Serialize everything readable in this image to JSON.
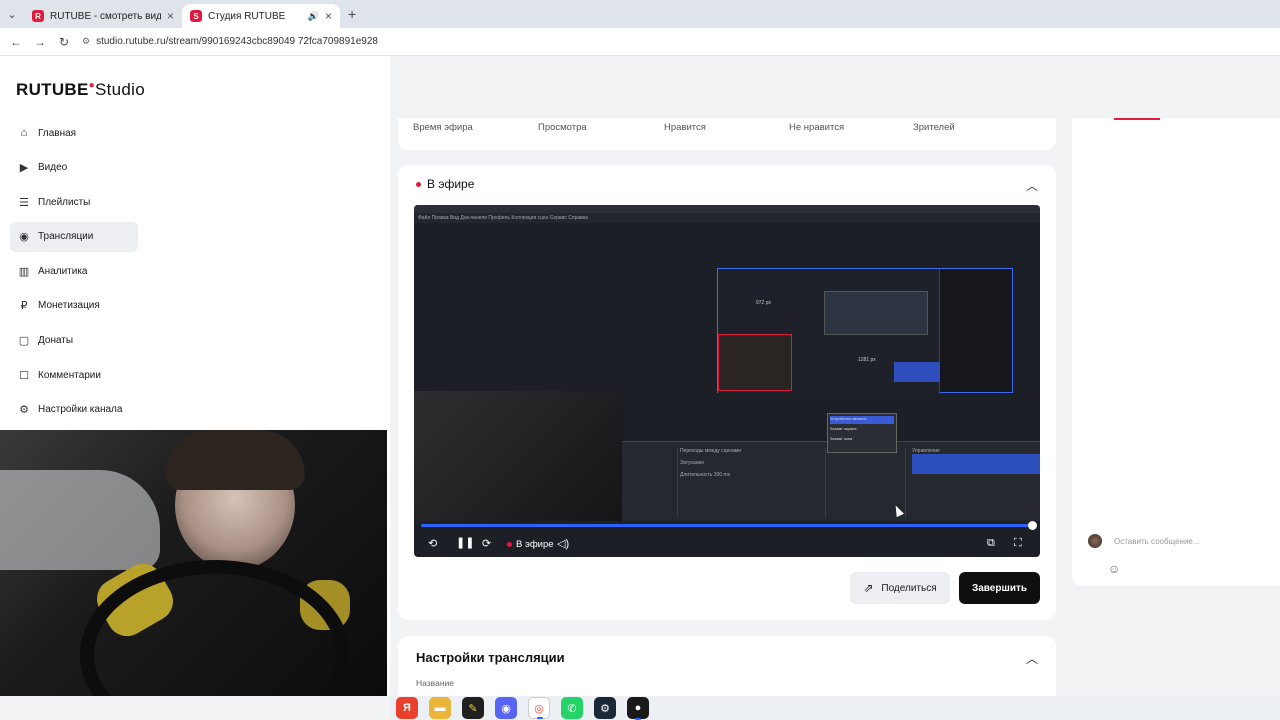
{
  "browser": {
    "tabs": [
      {
        "title": "RUTUBE - смотреть видео онл",
        "active": false,
        "icon": "rutube-favicon"
      },
      {
        "title": "Студия RUTUBE",
        "active": true,
        "icon": "rutube-favicon",
        "audio": true
      }
    ],
    "url": "studio.rutube.ru/stream/990169243cbc89049 72fca709891e928"
  },
  "logo": {
    "brand": "RUTUBE",
    "suffix": "Studio"
  },
  "sidebar": {
    "items": [
      {
        "label": "Главная",
        "icon": "home-icon",
        "active": false
      },
      {
        "label": "Видео",
        "icon": "video-icon",
        "active": false
      },
      {
        "label": "Плейлисты",
        "icon": "playlist-icon",
        "active": false
      },
      {
        "label": "Трансляции",
        "icon": "broadcast-icon",
        "active": true
      },
      {
        "label": "Аналитика",
        "icon": "analytics-icon",
        "active": false
      },
      {
        "label": "Монетизация",
        "icon": "monetization-icon",
        "active": false
      },
      {
        "label": "Донаты",
        "icon": "donate-icon",
        "active": false
      },
      {
        "label": "Комментарии",
        "icon": "comments-icon",
        "active": false
      },
      {
        "label": "Настройки канала",
        "icon": "gear-icon",
        "active": false
      }
    ]
  },
  "stats": {
    "labels": [
      "Время эфира",
      "Просмотра",
      "Нравится",
      "Не нравится",
      "Зрителей"
    ]
  },
  "live": {
    "title": "В эфире",
    "player_badge": "В эфире",
    "progress": 1.0,
    "obs": {
      "canvas_label_1": "972 px",
      "canvas_label_2": "1281 px",
      "dock_headers": [
        "Переходы между сценами",
        "Управление"
      ],
      "dock_row_1": "Затухание",
      "dock_row_2": "Длительность  300 ms",
      "popup_rows": [
        "Устройство захвата",
        "Захват экрана",
        "Захват окна"
      ]
    },
    "share_label": "Поделиться",
    "finish_label": "Завершить"
  },
  "settings": {
    "title": "Настройки трансляции",
    "field_label": "Название"
  },
  "chat": {
    "input_placeholder": "Оставить сообщение..."
  },
  "colors": {
    "accent": "#e01c3c",
    "progress": "#2b63ff",
    "finish_button": "#0f0f0f"
  }
}
